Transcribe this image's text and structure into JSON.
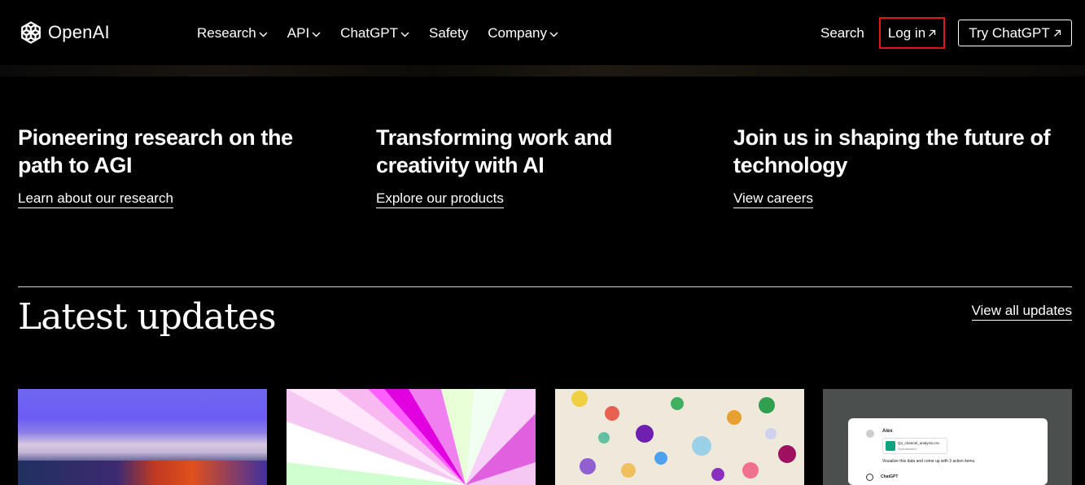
{
  "brand": {
    "name": "OpenAI"
  },
  "nav": {
    "items": [
      {
        "label": "Research",
        "has_dropdown": true
      },
      {
        "label": "API",
        "has_dropdown": true
      },
      {
        "label": "ChatGPT",
        "has_dropdown": true
      },
      {
        "label": "Safety",
        "has_dropdown": false
      },
      {
        "label": "Company",
        "has_dropdown": true
      }
    ],
    "search_label": "Search",
    "login_label": "Log in",
    "try_label": "Try ChatGPT"
  },
  "columns": [
    {
      "heading": "Pioneering research on the path to AGI",
      "link": "Learn about our research"
    },
    {
      "heading": "Transforming work and creativity with AI",
      "link": "Explore our products"
    },
    {
      "heading": "Join us in shaping the future of technology",
      "link": "View careers"
    }
  ],
  "latest": {
    "title": "Latest updates",
    "view_all": "View all updates"
  },
  "cards": [
    {
      "name": "abstract-landscape-image"
    },
    {
      "name": "pink-rays-image"
    },
    {
      "name": "paint-blobs-image"
    },
    {
      "name": "chatgpt-screenshot-image",
      "chat": {
        "user": "Alex",
        "file_name": "Q4_channel_analysis.csv",
        "file_type": "Spreadsheet",
        "message": "Visualize this data and come up with 3 action items.",
        "assistant": "ChatGPT"
      }
    }
  ],
  "colors": {
    "background": "#000000",
    "text": "#ffffff",
    "login_highlight": "#e0161f"
  },
  "icons": [
    "openai-logo-icon",
    "chevron-down-icon",
    "external-arrow-icon"
  ]
}
